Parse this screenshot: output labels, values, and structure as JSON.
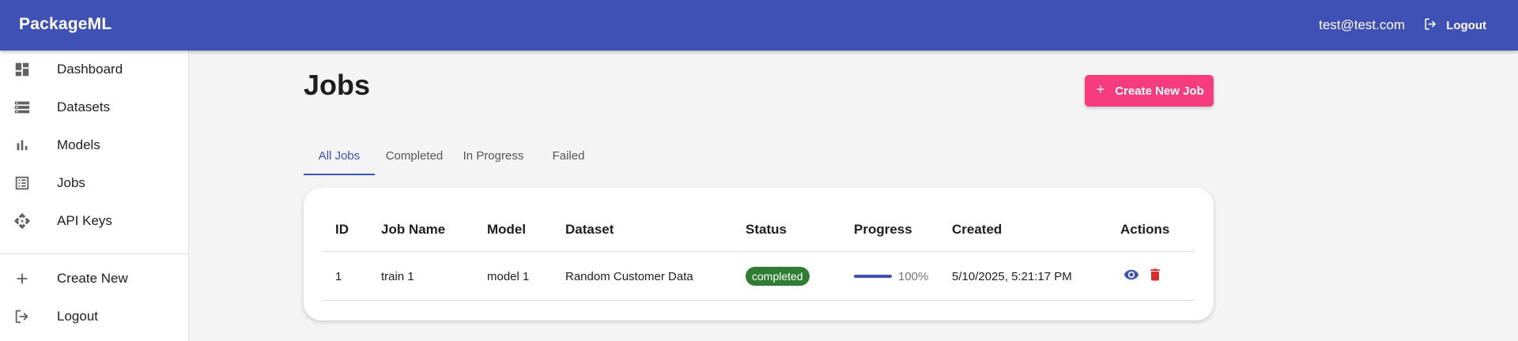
{
  "app": {
    "brand": "PackageML",
    "user_email": "test@test.com",
    "logout_label": "Logout"
  },
  "sidebar": {
    "items": [
      {
        "label": "Dashboard",
        "icon": "dashboard-icon"
      },
      {
        "label": "Datasets",
        "icon": "storage-icon"
      },
      {
        "label": "Models",
        "icon": "bar-chart-icon"
      },
      {
        "label": "Jobs",
        "icon": "list-alt-icon"
      },
      {
        "label": "API Keys",
        "icon": "api-icon"
      },
      {
        "label": "Create New",
        "icon": "plus-icon"
      },
      {
        "label": "Logout",
        "icon": "logout-icon"
      }
    ]
  },
  "page": {
    "title": "Jobs",
    "create_button": "Create New Job"
  },
  "tabs": [
    {
      "label": "All Jobs",
      "active": true
    },
    {
      "label": "Completed",
      "active": false
    },
    {
      "label": "In Progress",
      "active": false
    },
    {
      "label": "Failed",
      "active": false
    }
  ],
  "table": {
    "columns": [
      "ID",
      "Job Name",
      "Model",
      "Dataset",
      "Status",
      "Progress",
      "Created",
      "Actions"
    ],
    "rows": [
      {
        "id": "1",
        "job_name": "train 1",
        "model": "model 1",
        "dataset": "Random Customer Data",
        "status": "completed",
        "progress": 100,
        "progress_label": "100%",
        "created": "5/10/2025, 5:21:17 PM"
      }
    ]
  },
  "colors": {
    "primary": "#3f51b5",
    "accent": "#f73c7d",
    "status_completed": "#2e7d32",
    "delete": "#d32f2f"
  }
}
